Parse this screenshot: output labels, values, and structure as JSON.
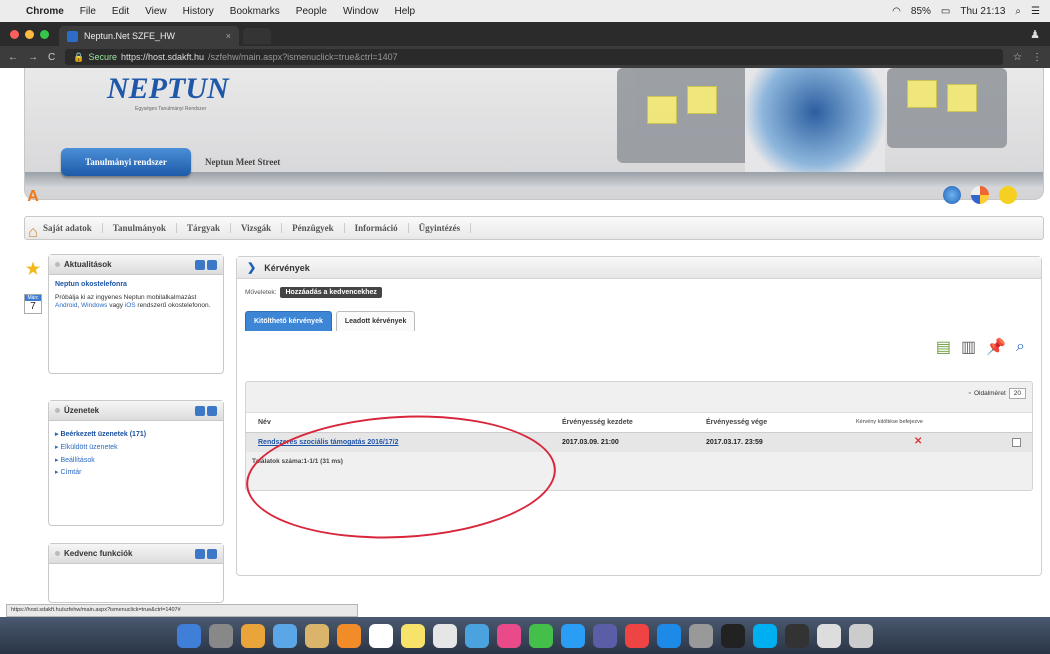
{
  "menubar": {
    "app": "Chrome",
    "items": [
      "File",
      "Edit",
      "View",
      "History",
      "Bookmarks",
      "People",
      "Window",
      "Help"
    ],
    "battery": "85%",
    "clock": "Thu 21:13"
  },
  "browser": {
    "tab_title": "Neptun.Net SZFE_HW",
    "secure_label": "Secure",
    "url_host": "https://host.sdakft.hu",
    "url_path": "/szfehw/main.aspx?ismenuclick=true&ctrl=1407"
  },
  "banner": {
    "logo": "NEPTUN",
    "logo_sub": "Egységes Tanulmányi Rendszer",
    "system_tab": "Tanulmányi rendszer",
    "meet_street": "Neptun Meet Street"
  },
  "nav": {
    "items": [
      "Saját adatok",
      "Tanulmányok",
      "Tárgyak",
      "Vizsgák",
      "Pénzügyek",
      "Információ",
      "Ügyintézés"
    ]
  },
  "news": {
    "title": "Aktualitások",
    "headline": "Neptun okostelefonra",
    "body_1": "Próbálja ki az ingyenes Neptun mobilalkalmazást",
    "link_android": "Android",
    "body_2": ", ",
    "link_windows": "Windows",
    "body_3": " vagy ",
    "link_ios": "iOS",
    "body_4": " rendszerű okostelefonon."
  },
  "messages": {
    "title": "Üzenetek",
    "items": [
      "Beérkezett üzenetek (171)",
      "Elküldött üzenetek",
      "Beállítások",
      "Címtár"
    ]
  },
  "favorites": {
    "title": "Kedvenc funkciók"
  },
  "side": {
    "cal_month": "Márc",
    "cal_day": "7"
  },
  "main": {
    "title": "Kérvények",
    "actions_label": "Műveletek:",
    "add_favorite": "Hozzáadás a kedvencekhez",
    "tabs": [
      "Kitölthető kérvények",
      "Leadott kérvények"
    ],
    "page_size_label": "Oldalméret",
    "page_size_value": "20",
    "columns": [
      "Név",
      "Érvényesség kezdete",
      "Érvényesség vége",
      "Kérvény kitöltése befejezve"
    ],
    "row": {
      "name": "Rendszeres szociális támogatás 2016/17/2",
      "start": "2017.03.09. 21:00",
      "end": "2017.03.17. 23:59"
    },
    "footer": "Találatok száma:1-1/1 (31 ms)"
  },
  "status_url": "https://host.sdakft.hu/szfehw/main.aspx?ismenuclick=true&ctrl=1407#",
  "colors": {
    "accent": "#1f5fb5",
    "annotation": "#d8263a"
  }
}
